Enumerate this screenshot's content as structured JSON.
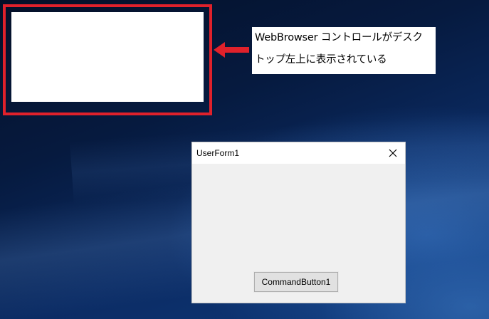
{
  "annotation": {
    "line1": "WebBrowser コントロールがデスク",
    "line2": "トップ左上に表示されている"
  },
  "userform": {
    "title": "UserForm1",
    "command_button_label": "CommandButton1"
  },
  "icons": {
    "close": "close-icon",
    "arrow": "arrow-left-icon"
  },
  "colors": {
    "highlight": "#e0212b",
    "desktop": "#061a3f",
    "form_background": "#f0f0f0"
  }
}
